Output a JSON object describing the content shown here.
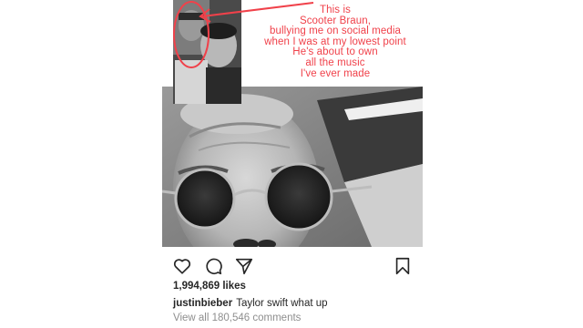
{
  "post": {
    "image": {
      "annotation_lines": "This is\nScooter Braun,\nbullying me on social media\nwhen I was at my lowest point\nHe's about to own\nall the music\nI've ever made",
      "annotation_color": "#f0414a"
    },
    "actions": {
      "like_icon": "heart-icon",
      "comment_icon": "comment-icon",
      "share_icon": "share-icon",
      "save_icon": "bookmark-icon"
    },
    "likes_text": "1,994,869 likes",
    "caption": {
      "username": "justinbieber",
      "text": "Taylor swift what up"
    },
    "comments_link": "View all 180,546 comments"
  }
}
